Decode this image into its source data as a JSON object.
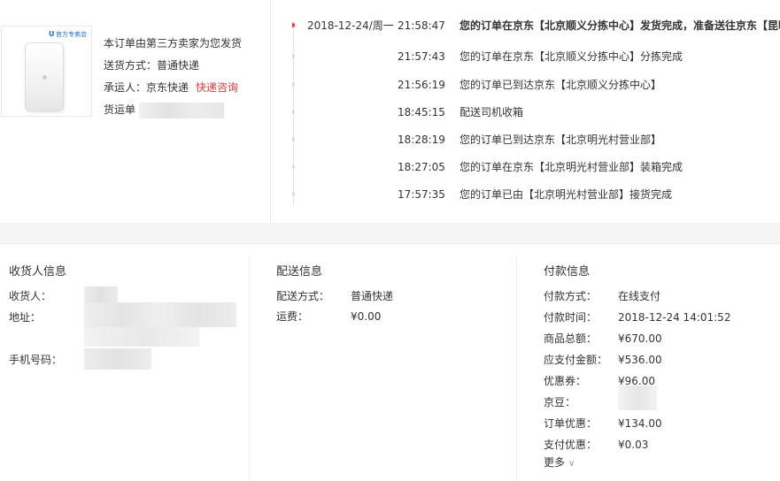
{
  "product": {
    "store_badge": "官方专卖店",
    "store_logo_letter": "U"
  },
  "shipping_panel": {
    "note": "本订单由第三方卖家为您发货",
    "method_label": "送货方式：",
    "method_value": "普通快递",
    "carrier_label": "承运人：",
    "carrier_value": "京东快递",
    "carrier_link": "快递咨询",
    "tracking_label": "货运单"
  },
  "tracking": {
    "events": [
      {
        "date": "2018-12-24/周一",
        "time": "21:58:47",
        "text": "您的订单在京东【北京顺义分拣中心】发货完成，准备送往京东【昆明",
        "active": true
      },
      {
        "date": "",
        "time": "21:57:43",
        "text": "您的订单在京东【北京顺义分拣中心】分拣完成",
        "active": false
      },
      {
        "date": "",
        "time": "21:56:19",
        "text": "您的订单已到达京东【北京顺义分拣中心】",
        "active": false
      },
      {
        "date": "",
        "time": "18:45:15",
        "text": "配送司机收箱",
        "active": false
      },
      {
        "date": "",
        "time": "18:28:19",
        "text": "您的订单已到达京东【北京明光村营业部】",
        "active": false
      },
      {
        "date": "",
        "time": "18:27:05",
        "text": "您的订单在京东【北京明光村营业部】装箱完成",
        "active": false
      },
      {
        "date": "",
        "time": "17:57:35",
        "text": "您的订单已由【北京明光村营业部】接货完成",
        "active": false
      }
    ]
  },
  "receiver": {
    "title": "收货人信息",
    "name_label": "收货人：",
    "address_label": "地址：",
    "phone_label": "手机号码："
  },
  "delivery": {
    "title": "配送信息",
    "method_label": "配送方式：",
    "method_value": "普通快递",
    "fee_label": "运费：",
    "fee_value": "¥0.00"
  },
  "payment": {
    "title": "付款信息",
    "rows": [
      {
        "label": "付款方式：",
        "value": "在线支付"
      },
      {
        "label": "付款时间：",
        "value": "2018-12-24 14:01:52"
      },
      {
        "label": "商品总额：",
        "value": "¥670.00"
      },
      {
        "label": "应支付金额：",
        "value": "¥536.00"
      },
      {
        "label": "优惠券：",
        "value": "¥96.00"
      },
      {
        "label": "京豆：",
        "value": ""
      },
      {
        "label": "订单优惠：",
        "value": "¥134.00"
      },
      {
        "label": "支付优惠：",
        "value": "¥0.03"
      }
    ],
    "more_label": "更多"
  },
  "colors": {
    "accent_red": "#e4393c",
    "band_gray": "#f5f5f5"
  }
}
